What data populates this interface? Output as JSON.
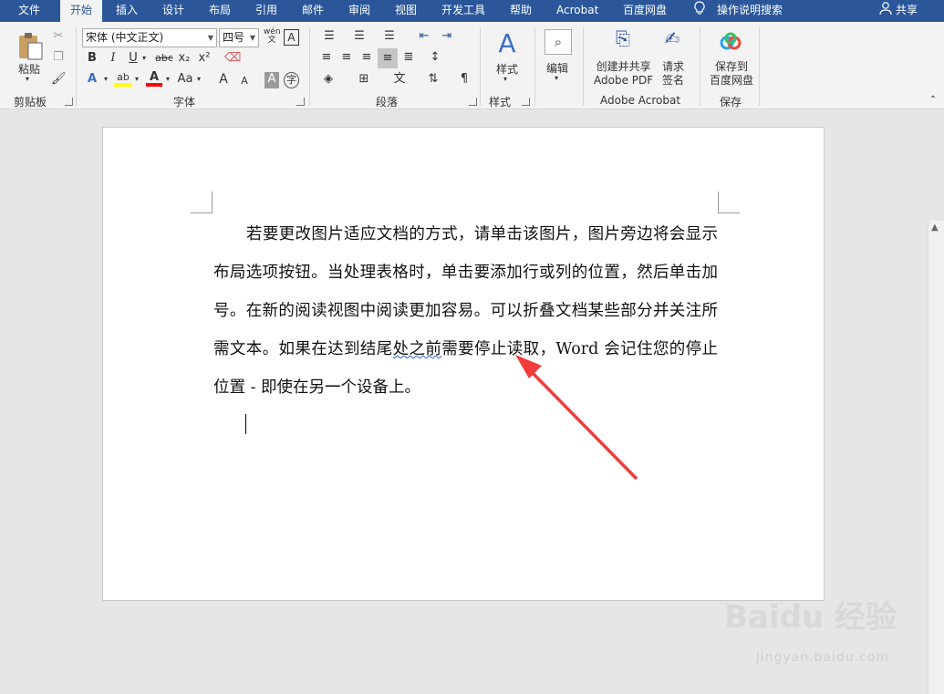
{
  "tabs": [
    {
      "label": "文件"
    },
    {
      "label": "开始"
    },
    {
      "label": "插入"
    },
    {
      "label": "设计"
    },
    {
      "label": "布局"
    },
    {
      "label": "引用"
    },
    {
      "label": "邮件"
    },
    {
      "label": "审阅"
    },
    {
      "label": "视图"
    },
    {
      "label": "开发工具"
    },
    {
      "label": "帮助"
    },
    {
      "label": "Acrobat"
    },
    {
      "label": "百度网盘"
    }
  ],
  "tell_me": "操作说明搜索",
  "share": "共享",
  "clipboard": {
    "paste": "粘贴",
    "group": "剪贴板"
  },
  "font": {
    "name": "宋体 (中文正文)",
    "size": "四号",
    "group": "字体",
    "bold": "B",
    "italic": "I",
    "underline": "U",
    "strike": "abc",
    "sub": "x₂",
    "sup": "x²",
    "case": "Aa",
    "grow": "A",
    "shrink": "A"
  },
  "paragraph": {
    "group": "段落"
  },
  "styles": {
    "label": "样式",
    "group": "样式"
  },
  "editing": {
    "label": "编辑"
  },
  "acrobat": {
    "create_line1": "创建并共享",
    "create_line2": "Adobe PDF",
    "sign_line1": "请求",
    "sign_line2": "签名",
    "group": "Adobe Acrobat"
  },
  "baidu": {
    "save_line1": "保存到",
    "save_line2": "百度网盘",
    "group": "保存"
  },
  "document": {
    "p1_a": "若要更改图片适应文档的方式，请单击该图片，图片旁边将会显示布局选项按钮。当处理表格时，单击要添加行或列的位置，然后单击加号。在新的阅读视图中阅读更加容易。可以折叠文档某些部分并关注所需文本。如果在达到结尾",
    "p1_sq": "处之前",
    "p1_b": "需要停止读取，Word 会记住您的停止位置 - 即使在另一个设备上。"
  },
  "colors": {
    "tabbar": "#2b579a",
    "arrow": "#f03c3c",
    "highlight": "#ffff00",
    "font_color": "#ff0000"
  },
  "watermark": {
    "brand": "Baidu 经验",
    "url": "jingyan.baidu.com"
  }
}
